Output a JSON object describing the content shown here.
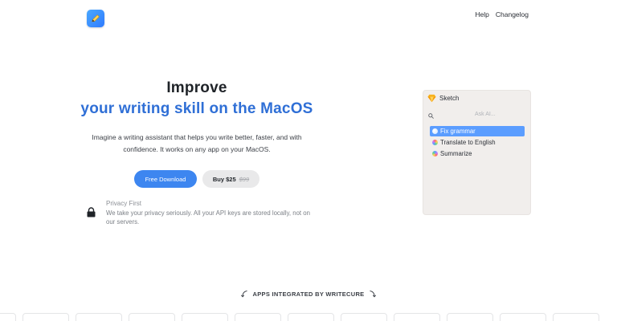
{
  "header": {
    "logo_icon": "pencil-icon",
    "nav": [
      {
        "label": "Help"
      },
      {
        "label": "Changelog"
      }
    ]
  },
  "hero": {
    "title": "Improve",
    "subtitle": "your writing skill on the MacOS",
    "description": "Imagine a writing assistant that helps you write better, faster, and with confidence. It works on any app on your MacOS.",
    "primary_button": "Free Download",
    "buy_button": {
      "price": "Buy $25",
      "old_price": "$99"
    },
    "accent_color": "#2f6fd6"
  },
  "privacy": {
    "icon": "lock-icon",
    "title": "Privacy First",
    "text": "We take your privacy seriously. All your API keys are stored locally, not on our servers."
  },
  "panel": {
    "app_name": "Sketch",
    "app_icon": "sketch-diamond-icon",
    "search_placeholder": "Ask AI...",
    "items": [
      {
        "label": "Fix grammar",
        "active": true
      },
      {
        "label": "Translate to English",
        "active": false
      },
      {
        "label": "Summarize",
        "active": false
      }
    ]
  },
  "apps_section": {
    "heading": "APPS INTEGRATED BY WRITECURE",
    "tile_count": 12
  }
}
